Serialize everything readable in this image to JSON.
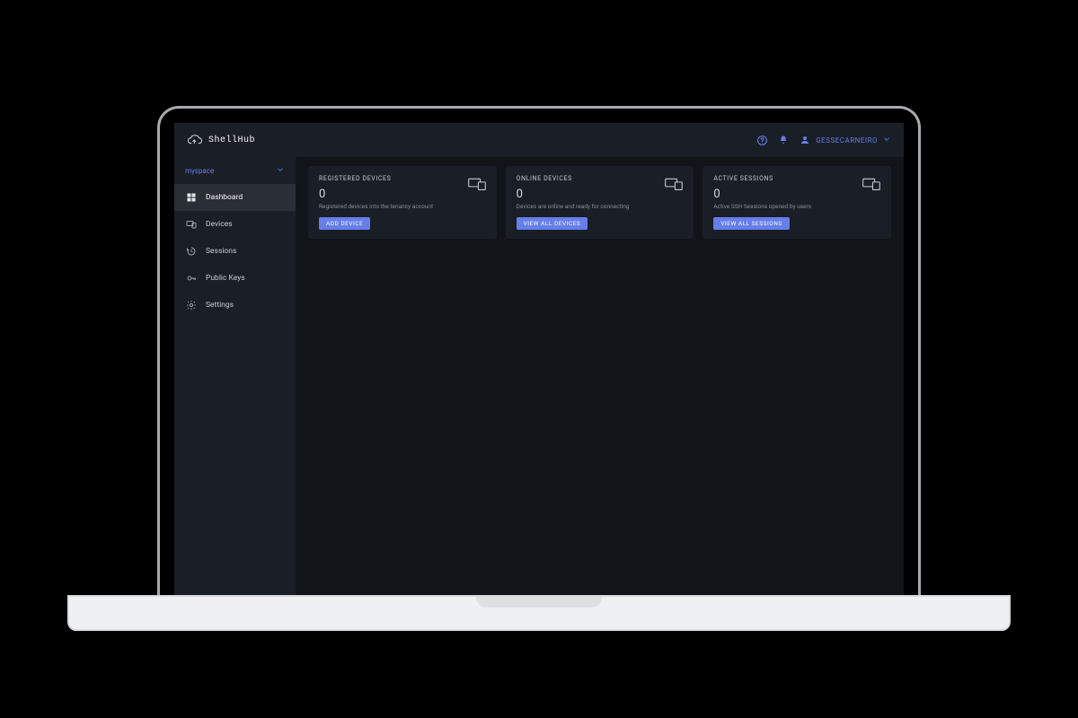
{
  "app_name": "ShellHub",
  "header": {
    "username": "GESSECARNEIRO"
  },
  "sidebar": {
    "namespace": "myspace",
    "items": [
      {
        "label": "Dashboard"
      },
      {
        "label": "Devices"
      },
      {
        "label": "Sessions"
      },
      {
        "label": "Public Keys"
      },
      {
        "label": "Settings"
      }
    ]
  },
  "cards": {
    "registered": {
      "title": "REGISTERED DEVICES",
      "count": "0",
      "desc": "Registered devices into the tenancy account",
      "button": "ADD DEVICE"
    },
    "online": {
      "title": "ONLINE DEVICES",
      "count": "0",
      "desc": "Devices are online and ready for connecting",
      "button": "VIEW ALL DEVICES"
    },
    "sessions": {
      "title": "ACTIVE SESSIONS",
      "count": "0",
      "desc": "Active SSH Sessions opened by users",
      "button": "VIEW ALL SESSIONS"
    }
  },
  "colors": {
    "accent": "#667EEA",
    "panel": "#1A1E27",
    "bg": "#111419"
  }
}
